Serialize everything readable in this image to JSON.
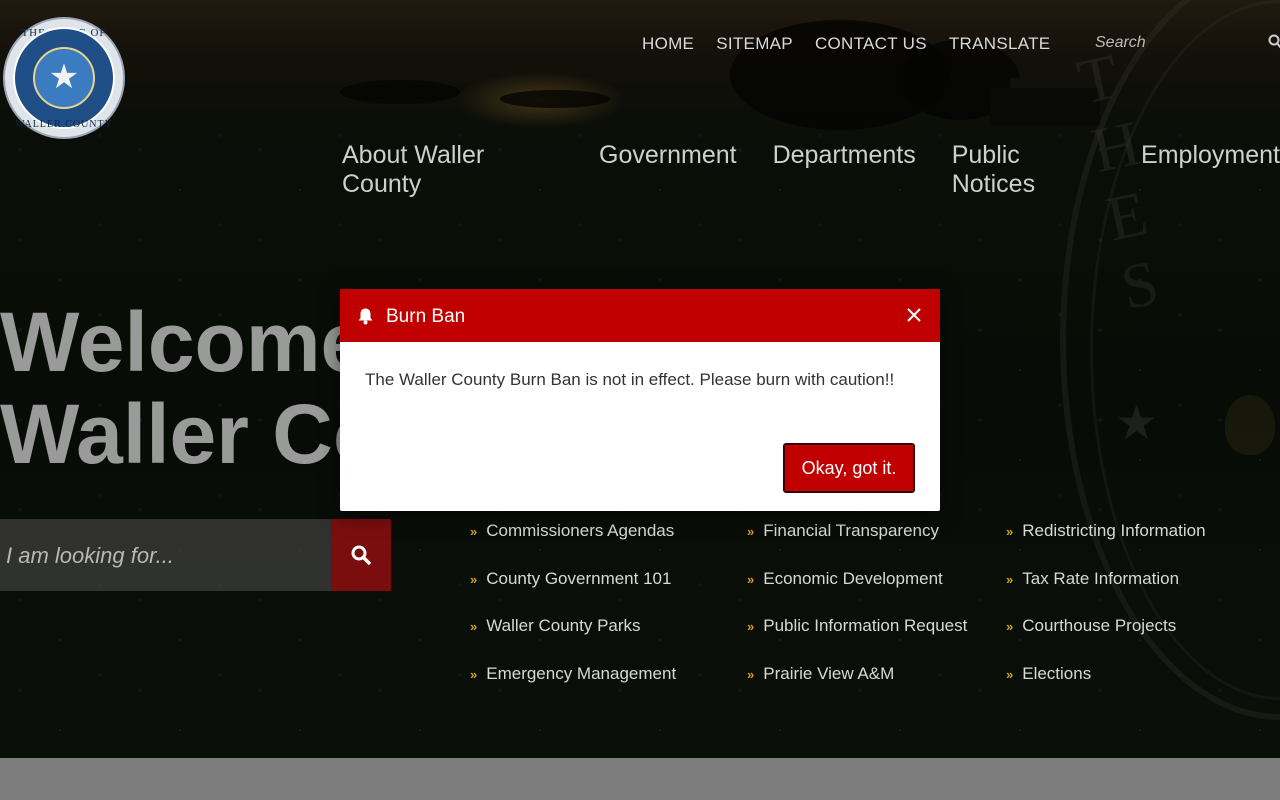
{
  "colors": {
    "accent_red": "#c00000",
    "dark_red": "#7a0e0e",
    "chevron_gold": "#d4a017"
  },
  "logo": {
    "top_text": "THE STATE OF TEXAS",
    "bottom_text": "WALLER COUNTY",
    "icon": "county-seal"
  },
  "top_nav": [
    {
      "label": "HOME"
    },
    {
      "label": "SITEMAP"
    },
    {
      "label": "CONTACT US"
    },
    {
      "label": "TRANSLATE"
    }
  ],
  "top_search": {
    "placeholder": "Search",
    "icon": "search-icon"
  },
  "main_nav": [
    {
      "label": "About Waller County"
    },
    {
      "label": "Government"
    },
    {
      "label": "Departments"
    },
    {
      "label": "Public Notices"
    },
    {
      "label": "Employment"
    }
  ],
  "hero": {
    "welcome": "Welcome to\nWaller County"
  },
  "lookfor": {
    "placeholder": "I am looking for...",
    "icon": "search-icon"
  },
  "quick_links": [
    [
      "Commissioners Agendas",
      "County Government 101",
      "Waller County Parks",
      "Emergency Management"
    ],
    [
      "Financial Transparency",
      "Economic Development",
      "Public Information Request",
      "Prairie View A&M"
    ],
    [
      "Redistricting Information",
      "Tax Rate Information",
      "Courthouse Projects",
      "Elections"
    ]
  ],
  "modal": {
    "title": "Burn Ban",
    "icon": "bell-icon",
    "body": "The Waller County Burn Ban is not in effect. Please burn with caution!!",
    "ok_label": "Okay, got it.",
    "close_icon": "close-icon"
  }
}
